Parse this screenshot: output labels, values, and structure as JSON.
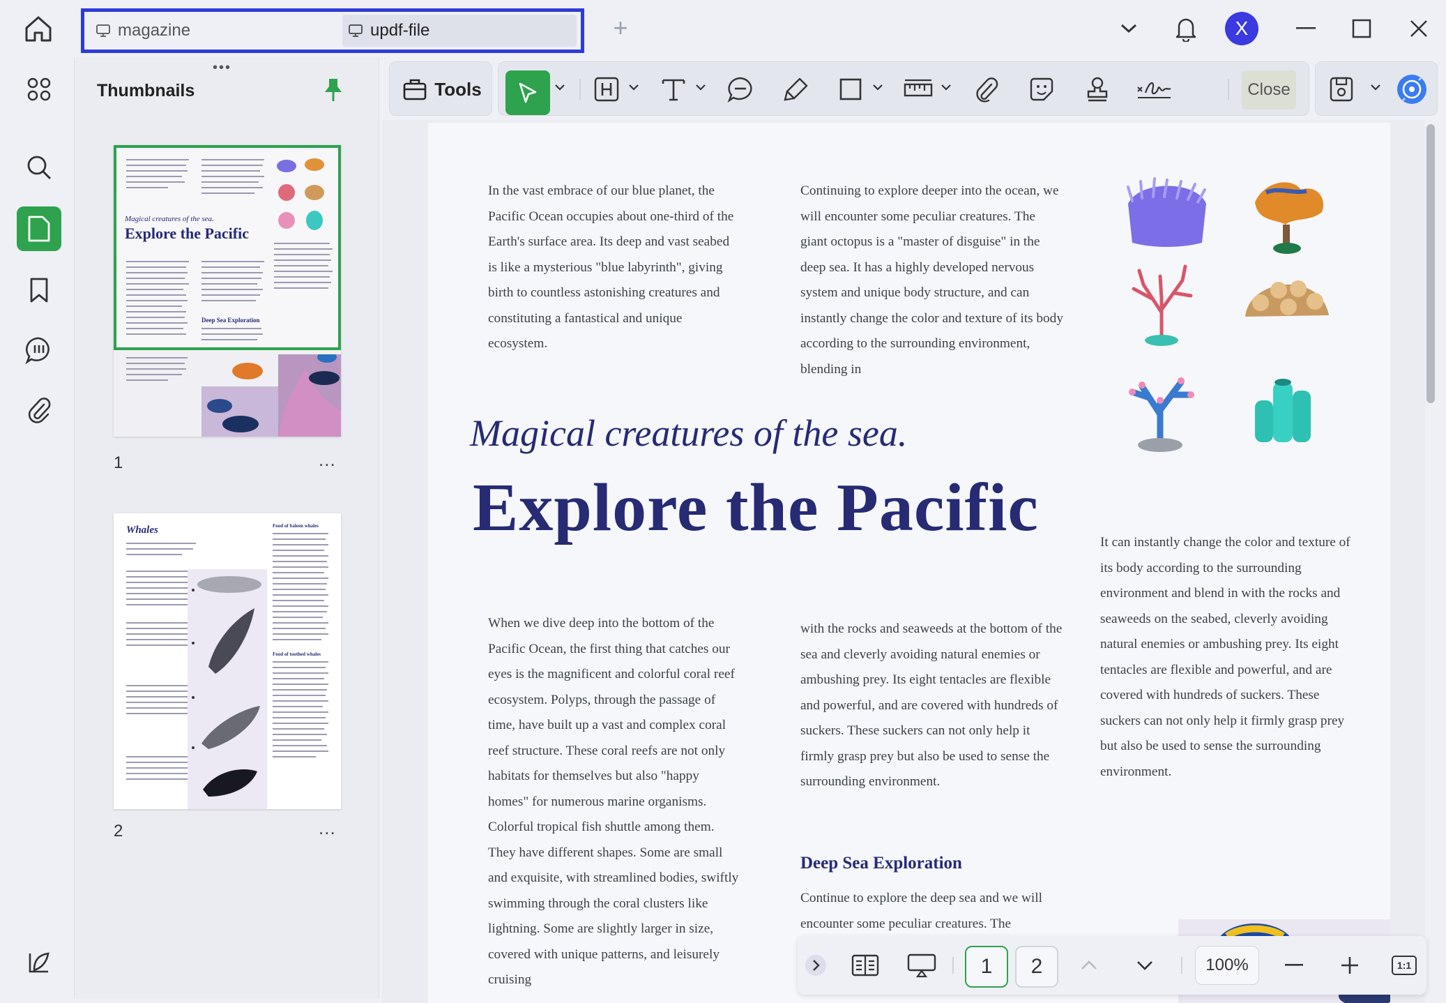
{
  "tabs": [
    {
      "label": "magazine"
    },
    {
      "label": "updf-file"
    }
  ],
  "user": {
    "initial": "X"
  },
  "sidebar": {
    "title": "Thumbnails",
    "pages": [
      {
        "number": "1",
        "thumb_subtitle": "Magical creatures of the sea.",
        "thumb_title": "Explore the Pacific",
        "thumb_heading": "Deep Sea Exploration"
      },
      {
        "number": "2",
        "thumb_title": "Whales",
        "thumb_sec1": "Food of baleen whales",
        "thumb_sec2": "Food of toothed whales"
      }
    ],
    "more_label": "..."
  },
  "toolbar": {
    "tools_label": "Tools",
    "close_label": "Close"
  },
  "document": {
    "col1": "In the vast embrace of our blue planet, the Pacific Ocean occupies about one-third of the Earth's surface area. Its deep and vast seabed is like a mysterious \"blue labyrinth\", giving birth to countless astonishing creatures and constituting a fantastical and unique ecosystem.",
    "col2": "Continuing to explore deeper into the ocean, we will encounter some peculiar creatures. The giant octopus is a \"master of disguise\" in the deep sea. It has a highly developed nervous system and unique body structure, and can instantly change the color and texture of its body according to the surrounding environment, blending in",
    "subtitle": "Magical creatures of the sea.",
    "title": "Explore the Pacific",
    "col3": "When we dive deep into the bottom of the Pacific Ocean, the first thing that catches our eyes is the magnificent and colorful coral reef ecosystem. Polyps, through the passage of time, have built up a vast and complex coral reef structure. These coral reefs are not only habitats for themselves but also \"happy homes\" for numerous marine organisms. Colorful tropical fish shuttle among them. They have different shapes. Some are small and exquisite, with streamlined bodies, swiftly swimming through the coral clusters like lightning. Some are slightly larger in size, covered with unique patterns, and leisurely cruising",
    "col4": "with the rocks and seaweeds at the bottom of the sea and cleverly avoiding natural enemies or ambushing prey. Its eight tentacles are flexible and powerful, and are covered with hundreds of suckers. These suckers can not only help it firmly grasp prey but also be used to sense the surrounding environment.",
    "col5": "It can instantly change the color and texture of its body according to the surrounding environment and blend in with the rocks and seaweeds on the seabed, cleverly avoiding natural enemies or ambushing prey. Its eight tentacles are flexible and powerful, and are covered with hundreds of suckers. These suckers can not only help it firmly grasp prey but also be used to sense the surrounding environment.",
    "section_heading": "Deep Sea Exploration",
    "col6": "Continue to explore the deep sea and we will encounter some peculiar creatures. The"
  },
  "bottombar": {
    "page1": "1",
    "page2": "2",
    "zoom": "100%",
    "fit_label": "1:1"
  },
  "colors": {
    "accent_green": "#2ea24d",
    "tab_highlight": "#2f3bd6",
    "title_navy": "#262b74",
    "avatar_blue": "#3a3ae0"
  }
}
